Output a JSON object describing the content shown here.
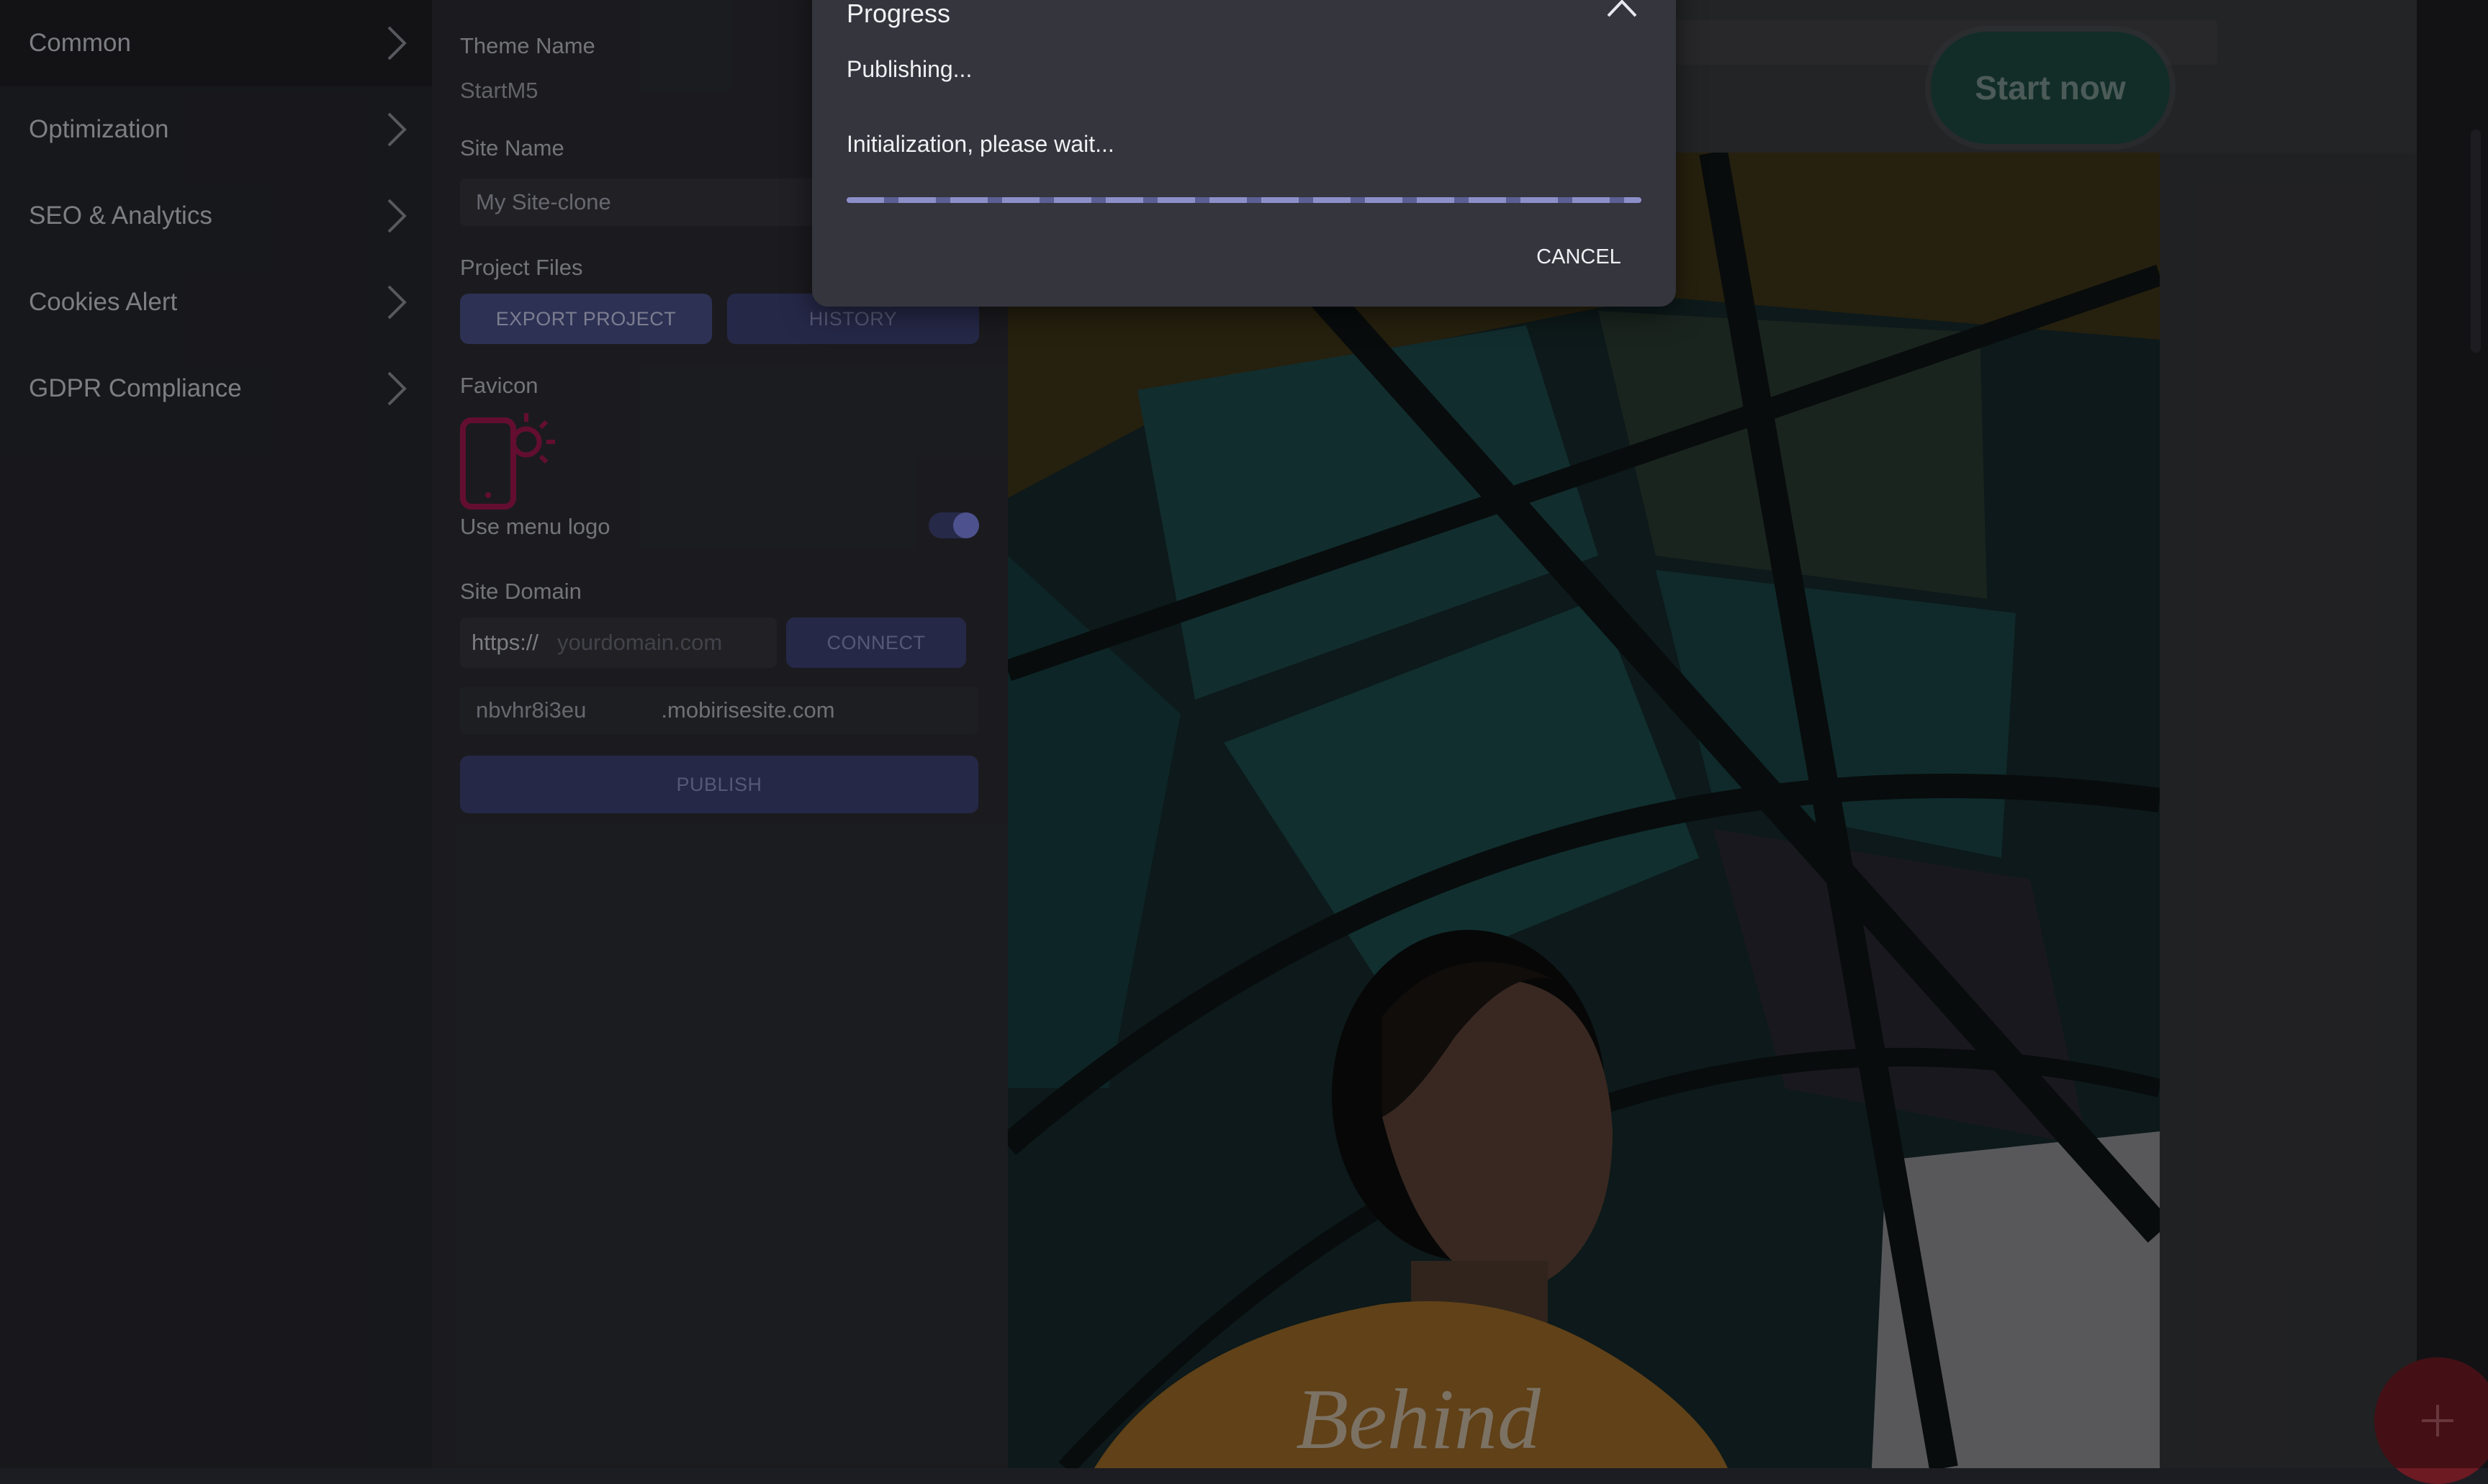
{
  "sidebar": {
    "items": [
      {
        "label": "Common"
      },
      {
        "label": "Optimization"
      },
      {
        "label": "SEO & Analytics"
      },
      {
        "label": "Cookies Alert"
      },
      {
        "label": "GDPR Compliance"
      }
    ]
  },
  "settings": {
    "theme_name_label": "Theme Name",
    "theme_name_value": "StartM5",
    "site_name_label": "Site Name",
    "site_name_value": "My Site-clone",
    "project_files_label": "Project Files",
    "export_label": "EXPORT PROJECT",
    "history_label": "HISTORY",
    "favicon_label": "Favicon",
    "favicon_icon": "phone-sun-icon",
    "use_menu_logo_label": "Use menu logo",
    "use_menu_logo_on": true,
    "site_domain_label": "Site Domain",
    "protocol": "https://",
    "domain_placeholder": "yourdomain.com",
    "connect_label": "CONNECT",
    "subdomain_value": "nbvhr8i3eu",
    "subdomain_suffix": ".mobirisesite.com",
    "publish_label": "PUBLISH"
  },
  "preview": {
    "start_button": "Start now",
    "shirt_text": "Behind",
    "fab_icon": "plus-icon"
  },
  "dialog": {
    "title": "Progress",
    "status": "Publishing...",
    "message": "Initialization, please wait...",
    "cancel_label": "CANCEL",
    "close_icon": "chevron-up-icon"
  },
  "colors": {
    "accent": "#4a4f88",
    "progress": "#8d90c8",
    "start_button": "#1d4a42",
    "fab": "#6e1a23",
    "favicon": "#a0184f"
  }
}
